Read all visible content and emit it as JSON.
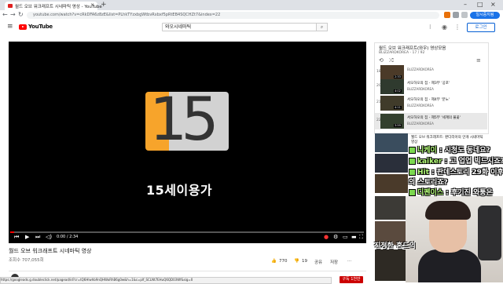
{
  "browser": {
    "tab_title": "월드 오브 워크래프트 시네마틱 영상 - YouTube",
    "tab_close": "×",
    "new_tab": "+",
    "url": "youtube.com/watch?v=cRkDFA6z8zE&list=PLhkTYzxbgWtbvRxbxf5pRtEB4SQCHZt7&index=22",
    "window_controls": [
      "–",
      "□",
      "×"
    ],
    "profile_label": "일시중지됨"
  },
  "header": {
    "logo_text": "YouTube",
    "search_value": "와오시네마틱",
    "search_icon": "search-icon",
    "login_label": "로그인"
  },
  "player": {
    "rating_number": "15",
    "rating_label": "15세이용가",
    "time": "0:00 / 2:34",
    "progress": 0.01
  },
  "video": {
    "title": "월드 오브 워크래프트 시네마틱 영상",
    "views": "조회수 707,055회",
    "likes": "770",
    "dislikes": "19",
    "share": "공유",
    "save": "저장",
    "subscribe": "구독 1천만"
  },
  "playlist": {
    "title": "월드 오브 워크래프트(와우) 영상모음",
    "subtitle": "BLIZZARDKOREA - 17 / 92",
    "items": [
      {
        "num": "18",
        "title": "",
        "channel": "BLIZZARDKOREA",
        "duration": "2:33"
      },
      {
        "num": "19",
        "title": "",
        "channel": "BLIZZARDKOREA",
        "duration": "1:41"
      },
      {
        "num": "20",
        "title": "서오하오의 집 - 제3부 '공포'",
        "channel": "BLIZZARDKOREA",
        "duration": "4:02"
      },
      {
        "num": "21",
        "title": "서오하오의 집 - 제4부 '분노'",
        "channel": "BLIZZARDKOREA",
        "duration": "4:11"
      },
      {
        "num": "22",
        "title": "서오하오의 집 - 제5부 '세계의 불꽃'",
        "channel": "BLIZZARDKOREA",
        "duration": "3:59"
      },
      {
        "num": "23",
        "title": "",
        "channel": "",
        "duration": ""
      }
    ]
  },
  "recommended": [
    {
      "title": "월드 오브 워크래프트: 판다리아의 안개 시네마틱 영상"
    },
    {
      "title": ""
    },
    {
      "title": ""
    },
    {
      "title": ""
    }
  ],
  "chat": [
    {
      "nick": "니케이",
      "text": "시청도 동네요?"
    },
    {
      "nick": "kaiker",
      "text": "고 업업 빅드시죠?"
    },
    {
      "nick": "Hit",
      "text": "판데스토리 29화 이후"
    },
    {
      "nick": "",
      "text": "의 스토리죠?"
    },
    {
      "nick": "디펜이스",
      "text": "후기진 와퉁은"
    }
  ],
  "overlay": {
    "label": "진정한 혼드의"
  },
  "statusbar": "https://googleads.g.doubleclick.net/pagead/id?cr=tQ6Hlwhb9nQHWoRhB6g0w&h=1&c=plf_SCLNt7EHuQ6QD03Wf&sig=0"
}
